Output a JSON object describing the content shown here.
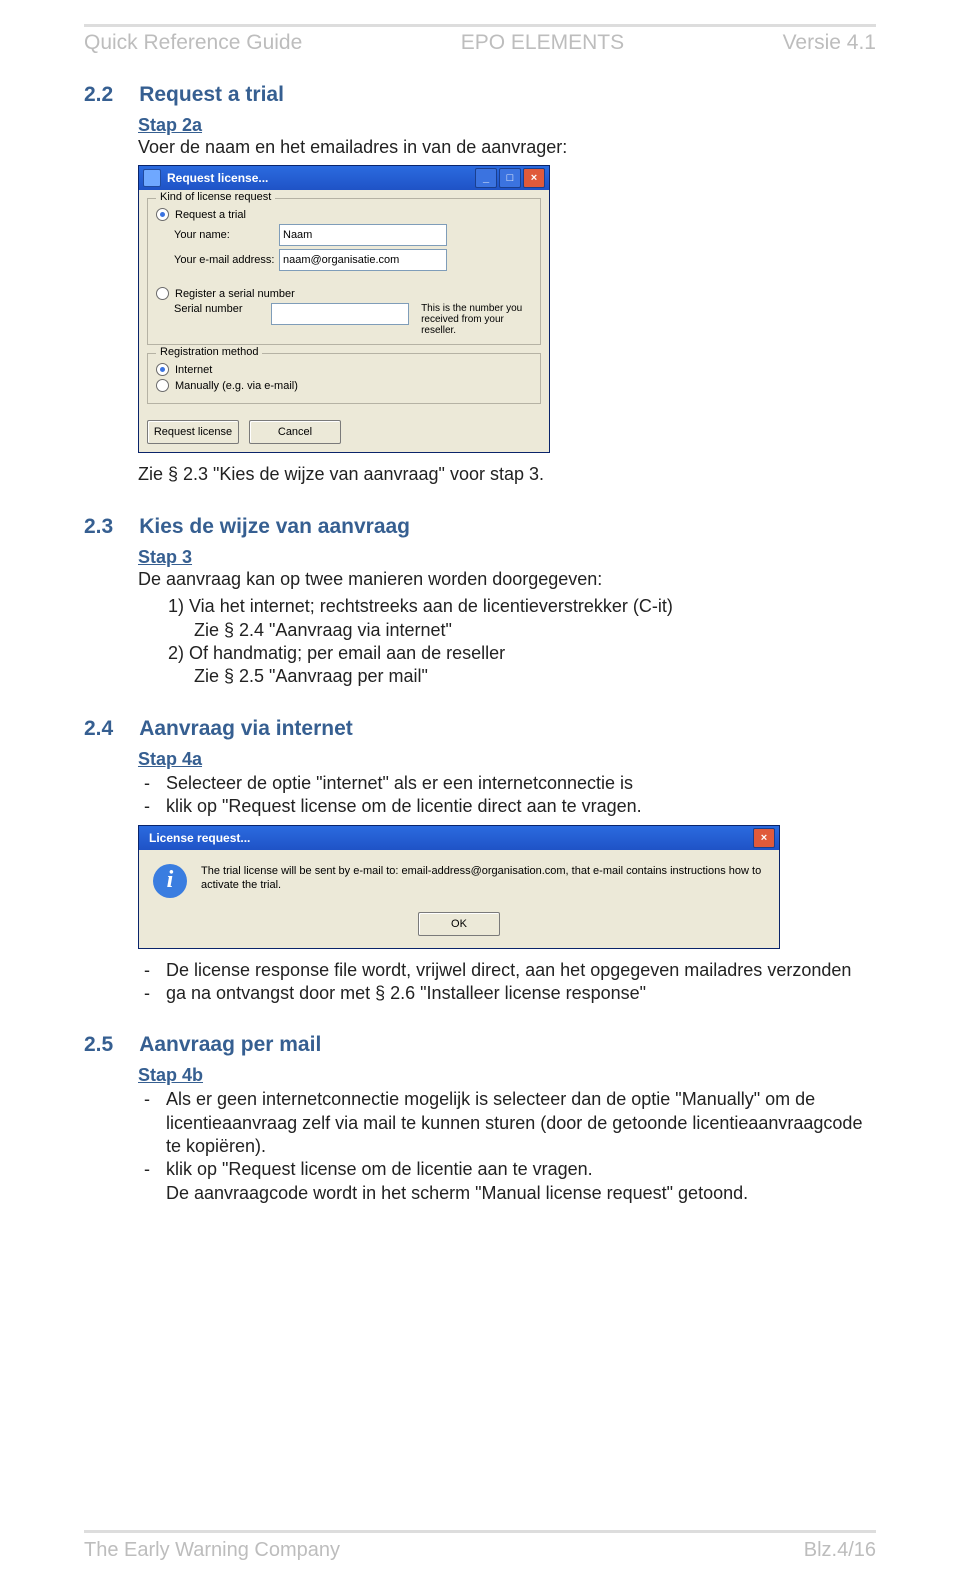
{
  "header": {
    "left": "Quick Reference Guide",
    "center": "EPO ELEMENTS",
    "right": "Versie 4.1"
  },
  "s22": {
    "num": "2.2",
    "title": "Request a trial",
    "step_label": "Stap 2a",
    "intro": "Voer de naam en het emailadres in van de aanvrager:",
    "after_img": "Zie § 2.3 \"Kies de wijze van aanvraag\" voor stap 3."
  },
  "dlg": {
    "title": "Request license...",
    "grp_kind": "Kind of license request",
    "opt_trial": "Request a trial",
    "lbl_name": "Your name:",
    "val_name": "Naam",
    "lbl_mail": "Your e-mail address:",
    "val_mail": "naam@organisatie.com",
    "opt_serial": "Register a serial number",
    "lbl_serial": "Serial number",
    "serial_note": "This is the number you received from your reseller.",
    "grp_method": "Registration method",
    "opt_internet": "Internet",
    "opt_manual": "Manually (e.g. via e-mail)",
    "btn_req": "Request license",
    "btn_cancel": "Cancel"
  },
  "s23": {
    "num": "2.3",
    "title": "Kies de wijze van aanvraag",
    "step_label": "Stap 3",
    "intro": "De aanvraag kan op twee manieren worden doorgegeven:",
    "item1_a": "1)  Via het internet; rechtstreeks aan de licentieverstrekker (C-it)",
    "item1_b": "Zie § 2.4 \"Aanvraag via internet\"",
    "item2_a": "2)  Of handmatig; per email aan de reseller",
    "item2_b": "Zie § 2.5 \"Aanvraag per mail\""
  },
  "s24": {
    "num": "2.4",
    "title": "Aanvraag via internet",
    "step_label": "Stap 4a",
    "b1": "Selecteer de optie \"internet\" als er een internetconnectie is",
    "b2": "klik op \"Request license om de licentie direct aan te vragen.",
    "b3": "De license response file wordt, vrijwel direct, aan het opgegeven mailadres verzonden",
    "b4": "ga na ontvangst door met § 2.6 \"Installeer license response\""
  },
  "msg": {
    "title": "License request...",
    "text": "The trial license will be sent by e-mail to: email-address@organisation.com, that e-mail contains instructions how to activate the trial.",
    "ok": "OK"
  },
  "s25": {
    "num": "2.5",
    "title": "Aanvraag per mail",
    "step_label": "Stap 4b",
    "b1": "Als er geen internetconnectie mogelijk is selecteer dan de optie \"Manually\" om de licentieaanvraag zelf via mail te kunnen sturen (door de getoonde licentieaanvraagcode te kopiëren).",
    "b2": "klik op \"Request license om de licentie aan te vragen.",
    "b2_line2": "De aanvraagcode wordt in het scherm \"Manual license request\" getoond."
  },
  "footer": {
    "left": "The Early Warning Company",
    "right": "Blz.4/16"
  }
}
